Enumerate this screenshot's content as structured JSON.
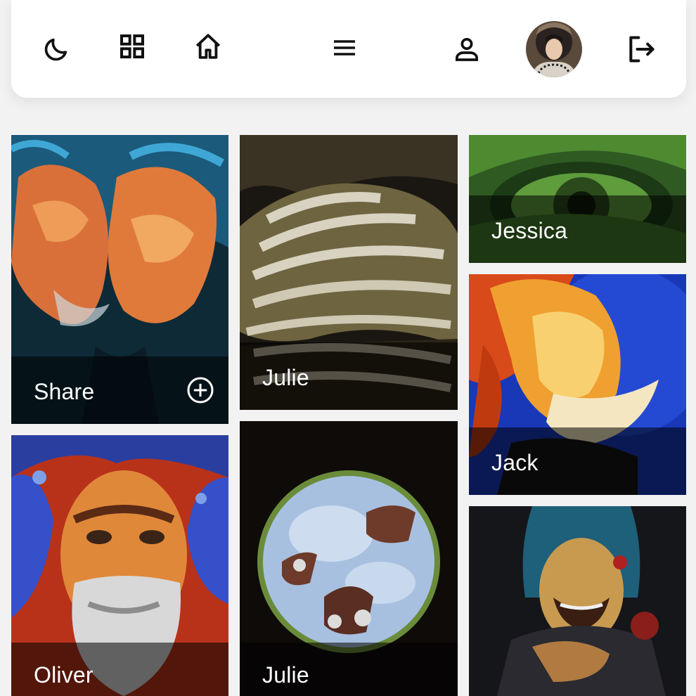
{
  "nav": {
    "icons": [
      "moon-icon",
      "grid-icon",
      "home-icon",
      "menu-icon",
      "user-icon",
      "avatar",
      "logout-icon"
    ]
  },
  "cards": [
    {
      "name": "card-share",
      "label": "Share",
      "action_icon": "plus-circle-icon"
    },
    {
      "name": "card-julie-zebra",
      "label": "Julie"
    },
    {
      "name": "card-jessica",
      "label": "Jessica"
    },
    {
      "name": "card-jack",
      "label": "Jack"
    },
    {
      "name": "card-oliver",
      "label": "Oliver"
    },
    {
      "name": "card-julie-circle",
      "label": "Julie"
    },
    {
      "name": "card-untitled"
    }
  ],
  "colors": {
    "background": "#f3f2f3",
    "navbar": "#ffffff",
    "caption_overlay": "rgba(0,0,0,0.55)",
    "icon": "#111111"
  }
}
